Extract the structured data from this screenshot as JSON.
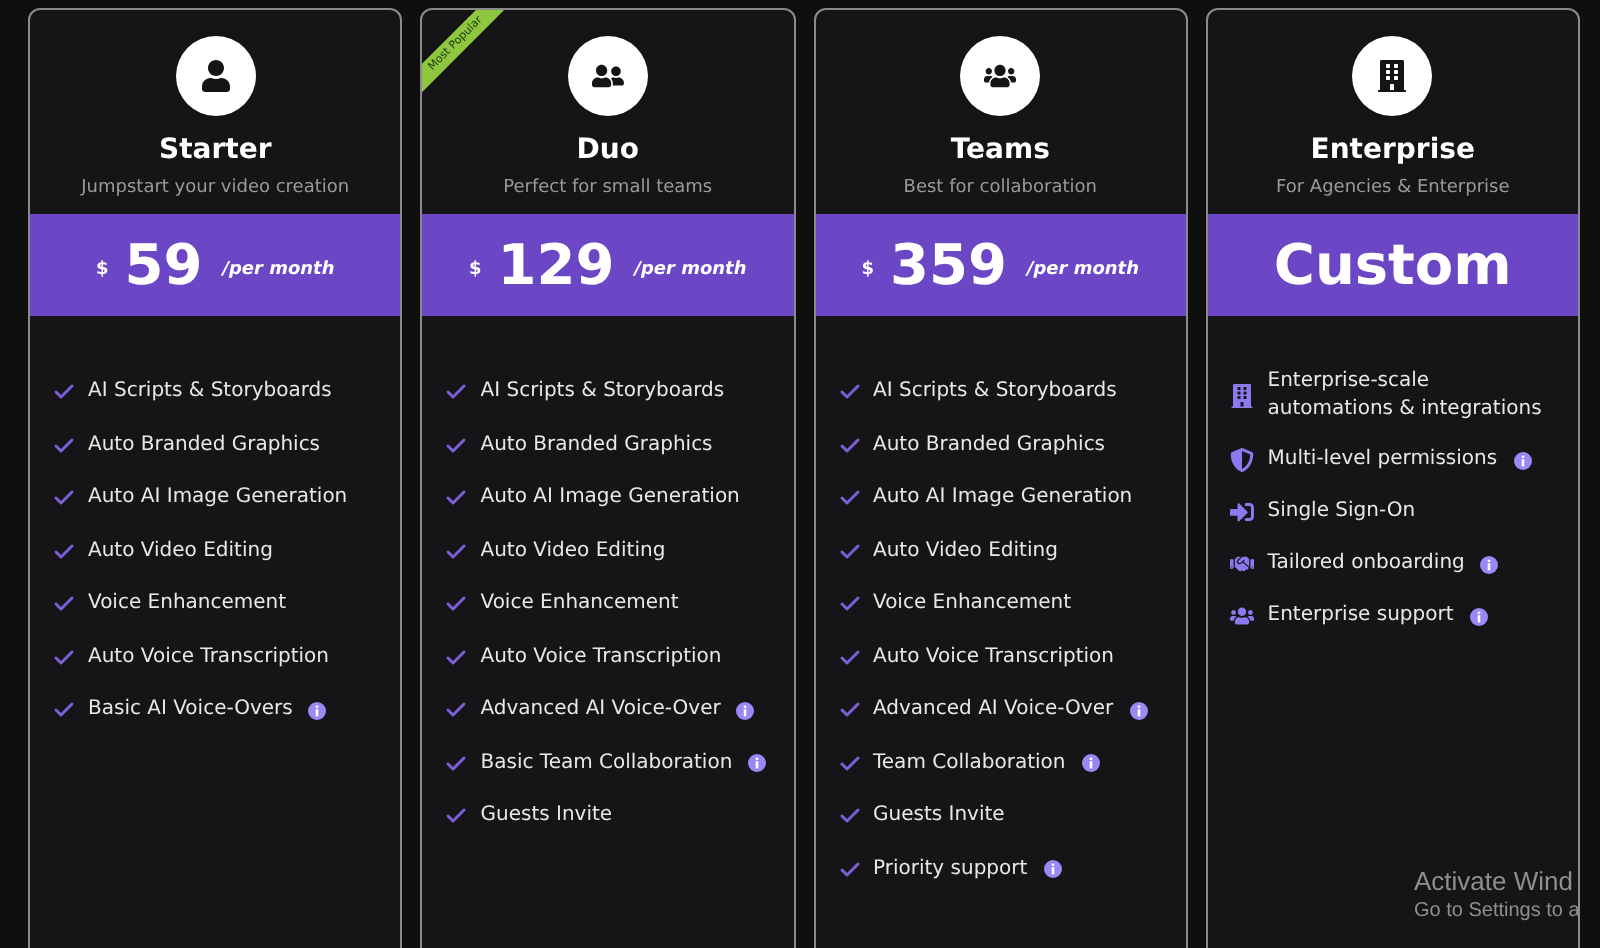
{
  "plans": [
    {
      "name": "Starter",
      "subtitle": "Jumpstart your video creation",
      "kind": "priced",
      "currency": "$",
      "amount": "59",
      "period": "/per month",
      "features": [
        {
          "kind": "check",
          "text": "AI Scripts & Storyboards",
          "info": false
        },
        {
          "kind": "check",
          "text": "Auto Branded Graphics",
          "info": false
        },
        {
          "kind": "check",
          "text": "Auto AI Image Generation",
          "info": false
        },
        {
          "kind": "check",
          "text": "Auto Video Editing",
          "info": false
        },
        {
          "kind": "check",
          "text": "Voice Enhancement",
          "info": false
        },
        {
          "kind": "check",
          "text": "Auto Voice Transcription",
          "info": false
        },
        {
          "kind": "check",
          "text": "Basic AI Voice-Overs",
          "info": true
        }
      ]
    },
    {
      "name": "Duo",
      "subtitle": "Perfect for small teams",
      "badge": "Most Popular",
      "kind": "priced",
      "currency": "$",
      "amount": "129",
      "period": "/per month",
      "features": [
        {
          "kind": "check",
          "text": "AI Scripts & Storyboards",
          "info": false
        },
        {
          "kind": "check",
          "text": "Auto Branded Graphics",
          "info": false
        },
        {
          "kind": "check",
          "text": "Auto AI Image Generation",
          "info": false
        },
        {
          "kind": "check",
          "text": "Auto Video Editing",
          "info": false
        },
        {
          "kind": "check",
          "text": "Voice Enhancement",
          "info": false
        },
        {
          "kind": "check",
          "text": "Auto Voice Transcription",
          "info": false
        },
        {
          "kind": "check",
          "text": "Advanced AI Voice-Over",
          "info": true
        },
        {
          "kind": "check",
          "text": "Basic Team Collaboration",
          "info": true
        },
        {
          "kind": "check",
          "text": "Guests Invite",
          "info": false
        }
      ]
    },
    {
      "name": "Teams",
      "subtitle": "Best for collaboration",
      "kind": "priced",
      "currency": "$",
      "amount": "359",
      "period": "/per month",
      "features": [
        {
          "kind": "check",
          "text": "AI Scripts & Storyboards",
          "info": false
        },
        {
          "kind": "check",
          "text": "Auto Branded Graphics",
          "info": false
        },
        {
          "kind": "check",
          "text": "Auto AI Image Generation",
          "info": false
        },
        {
          "kind": "check",
          "text": "Auto Video Editing",
          "info": false
        },
        {
          "kind": "check",
          "text": "Voice Enhancement",
          "info": false
        },
        {
          "kind": "check",
          "text": "Auto Voice Transcription",
          "info": false
        },
        {
          "kind": "check",
          "text": "Advanced AI Voice-Over",
          "info": true
        },
        {
          "kind": "check",
          "text": "Team Collaboration",
          "info": true
        },
        {
          "kind": "check",
          "text": "Guests Invite",
          "info": false
        },
        {
          "kind": "check",
          "text": "Priority support",
          "info": true
        }
      ]
    },
    {
      "name": "Enterprise",
      "subtitle": "For Agencies & Enterprise",
      "kind": "custom",
      "amount": "Custom",
      "features": [
        {
          "kind": "icon",
          "text": "Enterprise-scale automations & integrations",
          "info": false
        },
        {
          "kind": "icon",
          "text": "Multi-level permissions",
          "info": true
        },
        {
          "kind": "icon",
          "text": "Single Sign-On",
          "info": false
        },
        {
          "kind": "icon",
          "text": "Tailored onboarding",
          "info": true
        },
        {
          "kind": "icon",
          "text": "Enterprise support",
          "info": true
        }
      ]
    }
  ],
  "os_notice": {
    "title": "Activate Wind",
    "subtitle": "Go to Settings to a"
  }
}
